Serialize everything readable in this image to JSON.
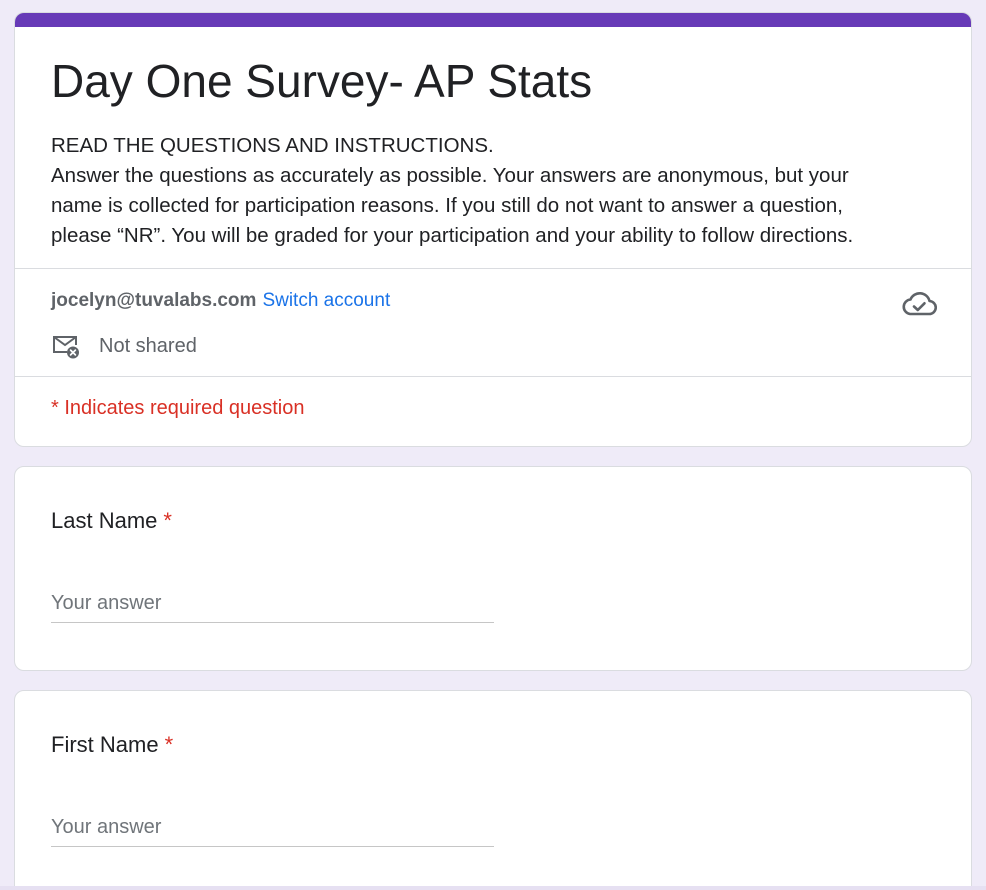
{
  "form": {
    "title": "Day One Survey- AP Stats",
    "description_lines": [
      "READ THE QUESTIONS AND INSTRUCTIONS.",
      "Answer the questions as accurately as possible.  Your answers are anonymous, but your",
      "name is collected for participation reasons.  If you still do not want to answer a question,",
      "please “NR”.  You will be graded for your participation and your ability to follow directions."
    ],
    "accent_color": "#673ab7"
  },
  "account": {
    "email": "jocelyn@tuvalabs.com",
    "switch_label": "Switch account",
    "shared_status": "Not shared",
    "mail_icon": "mail-not-shared-icon",
    "save_icon": "cloud-saved-icon"
  },
  "required_note": "* Indicates required question",
  "questions": [
    {
      "label": "Last Name",
      "required_mark": "*",
      "placeholder": "Your answer"
    },
    {
      "label": "First Name",
      "required_mark": "*",
      "placeholder": "Your answer"
    }
  ],
  "colors": {
    "background": "#efebf8",
    "link": "#1a73e8",
    "required": "#d93025"
  }
}
